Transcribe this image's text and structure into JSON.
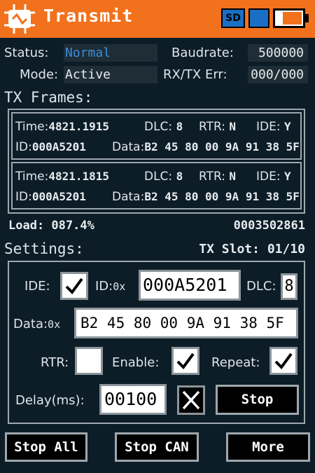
{
  "header": {
    "title": "Transmit",
    "sd_label": "SD",
    "battery_level": 0.72,
    "colors": {
      "bar": "#f2711c",
      "accent": "#1a6fc4"
    },
    "icon": "can-bus-logo-icon"
  },
  "status": {
    "status_label": "Status:",
    "status_value": "Normal",
    "baudrate_label": "Baudrate:",
    "baudrate_value": "500000",
    "mode_label": "Mode:",
    "mode_value": "Active",
    "err_label": "RX/TX Err:",
    "err_value": "000/000"
  },
  "tx_frames": {
    "title": "TX Frames:",
    "frames": [
      {
        "time_label": "Time:",
        "time": "4821.1915",
        "dlc_label": "DLC:",
        "dlc": "8",
        "rtr_label": "RTR:",
        "rtr": "N",
        "ide_label": "IDE:",
        "ide": "Y",
        "id_label": "ID:",
        "id": "000A5201",
        "data_label": "Data:",
        "data": "B2 45 80 00 9A 91 38 5F"
      },
      {
        "time_label": "Time:",
        "time": "4821.1815",
        "dlc_label": "DLC:",
        "dlc": "8",
        "rtr_label": "RTR:",
        "rtr": "N",
        "ide_label": "IDE:",
        "ide": "Y",
        "id_label": "ID:",
        "id": "000A5201",
        "data_label": "Data:",
        "data": "B2 45 80 00 9A 91 38 5F"
      }
    ],
    "load": "Load: 087.4%",
    "counter": "0003502861"
  },
  "settings": {
    "title": "Settings:",
    "tx_slot": "TX Slot: 01/10",
    "ide_label": "IDE:",
    "ide_checked": true,
    "id_label": "ID:",
    "id_prefix": "0x",
    "id_value": "000A5201",
    "dlc_label": "DLC:",
    "dlc_value": "8",
    "data_label": "Data:",
    "data_prefix": "0x",
    "data_value": "B2 45 80 00 9A 91 38 5F",
    "rtr_label": "RTR:",
    "rtr_checked": false,
    "enable_label": "Enable:",
    "enable_checked": true,
    "repeat_label": "Repeat:",
    "repeat_checked": true,
    "delay_label": "Delay(ms):",
    "delay_value": "00100",
    "stop_label": "Stop"
  },
  "bottom": {
    "stop_all": "Stop All",
    "stop_can": "Stop CAN",
    "more": "More"
  }
}
